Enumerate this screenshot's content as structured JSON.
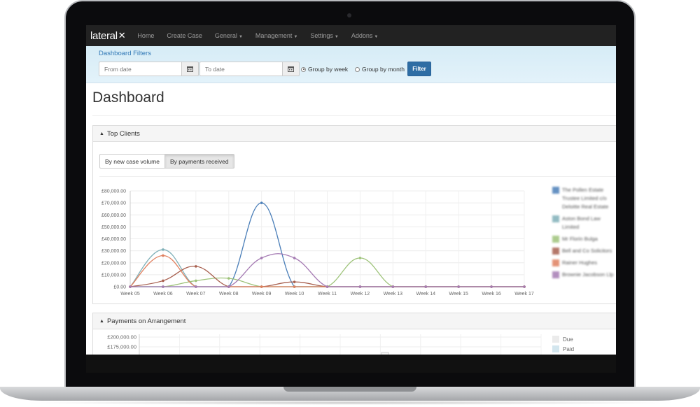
{
  "navbar": {
    "brand": "lateral",
    "brand_mark": "x-arrows",
    "items": [
      {
        "label": "Home",
        "dropdown": false
      },
      {
        "label": "Create Case",
        "dropdown": false
      },
      {
        "label": "General",
        "dropdown": true
      },
      {
        "label": "Management",
        "dropdown": true
      },
      {
        "label": "Settings",
        "dropdown": true
      },
      {
        "label": "Addons",
        "dropdown": true
      }
    ]
  },
  "filters": {
    "title": "Dashboard Filters",
    "from_placeholder": "From date",
    "to_placeholder": "To date",
    "group_week": "Group by week",
    "group_month": "Group by month",
    "selected_group": "week",
    "filter_label": "Filter"
  },
  "page": {
    "title": "Dashboard"
  },
  "top_clients": {
    "title": "Top Clients",
    "toggle": {
      "new_case": "By new case volume",
      "payments": "By payments received",
      "active": "payments"
    }
  },
  "payments": {
    "title": "Payments on Arrangement",
    "legend": [
      {
        "label": "Due",
        "color": "#ebebeb"
      },
      {
        "label": "Paid",
        "color": "#d3e6ee"
      }
    ],
    "y_ticks_visible": [
      "£200,000.00",
      "£175,000.00"
    ]
  },
  "chart_data": {
    "type": "line",
    "categories": [
      "Week 05",
      "Week 06",
      "Week 07",
      "Week 08",
      "Week 09",
      "Week 10",
      "Week 11",
      "Week 12",
      "Week 13",
      "Week 14",
      "Week 15",
      "Week 16",
      "Week 17"
    ],
    "ylim": [
      0,
      80000
    ],
    "y_ticks": [
      "£0.00",
      "£10,000.00",
      "£20,000.00",
      "£30,000.00",
      "£40,000.00",
      "£50,000.00",
      "£60,000.00",
      "£70,000.00",
      "£80,000.00"
    ],
    "grid": true,
    "legend_position": "right",
    "series": [
      {
        "name": "The Pollen Estate Trustee Limited c/o Deloitte Real Estate",
        "color": "#4a7eb8",
        "values": [
          0,
          0,
          0,
          0,
          70000,
          0,
          0,
          0,
          0,
          0,
          0,
          0,
          0
        ]
      },
      {
        "name": "Aston Bond Law Limited",
        "color": "#7fb0b8",
        "values": [
          0,
          31000,
          0,
          0,
          0,
          0,
          0,
          0,
          0,
          0,
          0,
          0,
          0
        ]
      },
      {
        "name": "Mr Florin Bulga",
        "color": "#9ec37a",
        "values": [
          0,
          0,
          5000,
          7000,
          0,
          0,
          0,
          24000,
          0,
          0,
          0,
          0,
          0
        ]
      },
      {
        "name": "Bell and Co Solicitors",
        "color": "#a8604f",
        "values": [
          0,
          5000,
          17000,
          0,
          0,
          4000,
          0,
          0,
          0,
          0,
          0,
          0,
          0
        ]
      },
      {
        "name": "Rainer Hughes",
        "color": "#e0805f",
        "values": [
          0,
          26000,
          0,
          0,
          0,
          0,
          0,
          0,
          0,
          0,
          0,
          0,
          0
        ]
      },
      {
        "name": "Brownie Jacobson Llp",
        "color": "#a57bb3",
        "values": [
          0,
          0,
          0,
          0,
          24000,
          24000,
          0,
          0,
          0,
          0,
          0,
          0,
          0
        ]
      }
    ]
  }
}
